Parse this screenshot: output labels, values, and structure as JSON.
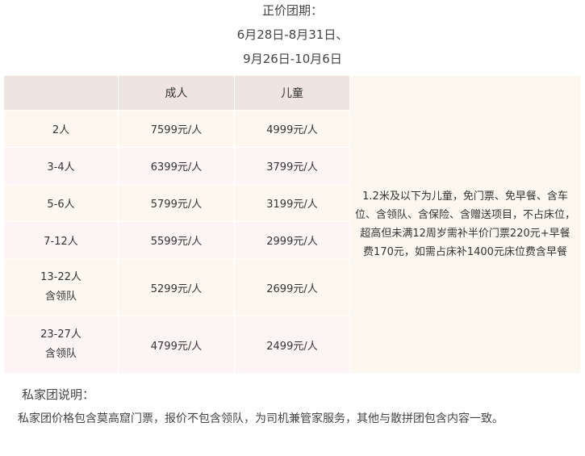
{
  "header": {
    "title": "正价团期：",
    "dates_line1": "6月28日-8月31日、",
    "dates_line2": "9月26日-10月6日"
  },
  "table": {
    "columns": [
      "",
      "成人",
      "儿童"
    ],
    "rows": [
      {
        "group": [
          "2人"
        ],
        "adult": "7599元/人",
        "child": "4999元/人"
      },
      {
        "group": [
          "3-4人"
        ],
        "adult": "6399元/人",
        "child": "3799元/人"
      },
      {
        "group": [
          "5-6人"
        ],
        "adult": "5799元/人",
        "child": "3199元/人"
      },
      {
        "group": [
          "7-12人"
        ],
        "adult": "5599元/人",
        "child": "2999元/人"
      },
      {
        "group": [
          "13-22人",
          "含领队"
        ],
        "adult": "5299元/人",
        "child": "2699元/人"
      },
      {
        "group": [
          "23-27人",
          "含领队"
        ],
        "adult": "4799元/人",
        "child": "2499元/人"
      }
    ],
    "note": "1.2米及以下为儿童，免门票、免早餐、含车位、含领队、含保险、含赠送项目，不占床位，超高但未满12周岁需补半价门票220元+早餐费170元，如需占床补1400元床位费含早餐"
  },
  "footer": {
    "title": "私家团说明：",
    "text": "私家团价格包含莫高窟门票，报价不包含领队，为司机兼管家服务，其他与散拼团包含内容一致。"
  },
  "colors": {
    "header_bg": "#efe4df",
    "row_bg_a": "#fcf8ef",
    "row_bg_b": "#fdf5f5"
  }
}
